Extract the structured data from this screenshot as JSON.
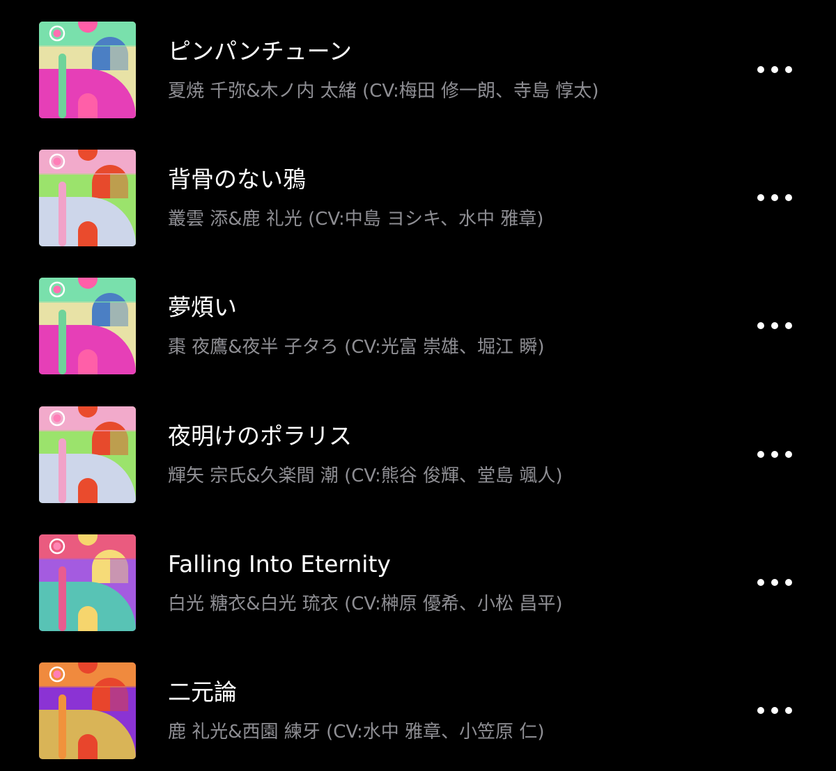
{
  "tracks": [
    {
      "title": "ピンパンチューン",
      "artist": "夏焼 千弥&木ノ内 太緒 (CV:梅田 修一朗、寺島 惇太)",
      "artwork_colors": {
        "bg": "#e8e2a6",
        "top": "#79e0ac",
        "arch": "#4b7fc4",
        "bottom": "#e63fb7",
        "stripe": "#6fd39a",
        "accent": "#ff5fa8",
        "logo": "#ff6fb1"
      }
    },
    {
      "title": "背骨のない鴉",
      "artist": "叢雲 添&鹿 礼光 (CV:中島 ヨシキ、水中 雅章)",
      "artwork_colors": {
        "bg": "#9be36c",
        "top": "#f2aacb",
        "arch": "#e74a2c",
        "bottom": "#cdd6ea",
        "stripe": "#f1a2c8",
        "accent": "#ea4b2d",
        "logo": "#ff7eb8"
      }
    },
    {
      "title": "夢煩い",
      "artist": "棗 夜鷹&夜半 子タろ (CV:光富 崇雄、堀江 瞬)",
      "artwork_colors": {
        "bg": "#e8e2a6",
        "top": "#79e0ac",
        "arch": "#4b7fc4",
        "bottom": "#e63fb7",
        "stripe": "#6fd39a",
        "accent": "#ff5fa8",
        "logo": "#ff6fb1"
      }
    },
    {
      "title": "夜明けのポラリス",
      "artist": "輝矢 宗氏&久楽間 潮 (CV:熊谷 俊輝、堂島 颯人)",
      "artwork_colors": {
        "bg": "#9be36c",
        "top": "#f2aacb",
        "arch": "#e74a2c",
        "bottom": "#cdd6ea",
        "stripe": "#f1a2c8",
        "accent": "#ea4b2d",
        "logo": "#ff7eb8"
      }
    },
    {
      "title": "Falling Into Eternity",
      "artist": "白光 糖衣&白光 琉衣 (CV:榊原 優希、小松 昌平)",
      "artwork_colors": {
        "bg": "#a45be0",
        "top": "#ea5b7f",
        "arch": "#f6db78",
        "bottom": "#58c3b5",
        "stripe": "#e95c8f",
        "accent": "#f6d56d",
        "logo": "#ff86b5"
      }
    },
    {
      "title": "二元論",
      "artist": "鹿 礼光&西園 練牙 (CV:水中 雅章、小笠原 仁)",
      "artwork_colors": {
        "bg": "#8b33d4",
        "top": "#f08a3e",
        "arch": "#e8452c",
        "bottom": "#d9b457",
        "stripe": "#f1923c",
        "accent": "#e8452c",
        "logo": "#ff7eb8"
      }
    }
  ],
  "icons": {
    "more": "ellipsis-horizontal-icon",
    "artwork_logo": "b-logo-icon"
  },
  "colors": {
    "background": "#000000",
    "title": "#ffffff",
    "subtitle": "#8e8e93",
    "more_dots": "#ffffff"
  }
}
